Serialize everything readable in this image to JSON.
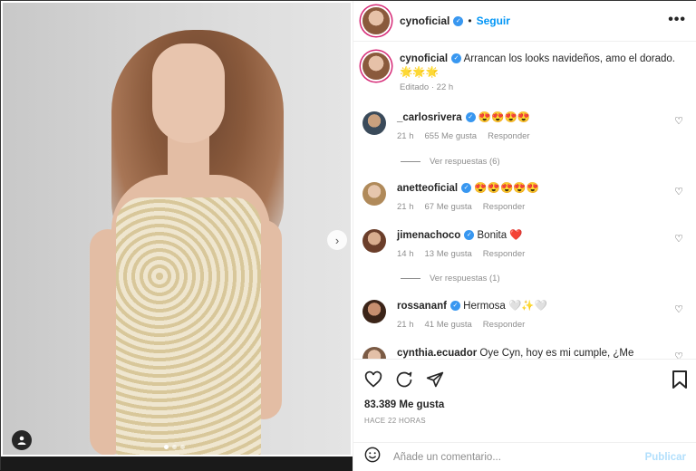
{
  "post": {
    "username": "cynoficial",
    "follow_label": "Seguir",
    "more_label": "•••",
    "caption_text": "Arrancan los looks navideños, amo el dorado. 🌟🌟🌟",
    "caption_meta": "Editado · 22 h"
  },
  "comments": [
    {
      "user": "_carlosrivera",
      "text": "😍😍😍😍",
      "time": "21 h",
      "likes": "655 Me gusta",
      "reply": "Responder",
      "view_replies": "Ver respuestas (6)"
    },
    {
      "user": "anetteoficial",
      "text": "😍😍😍😍😍",
      "time": "21 h",
      "likes": "67 Me gusta",
      "reply": "Responder",
      "view_replies": ""
    },
    {
      "user": "jimenachoco",
      "text": "Bonita ❤️",
      "time": "14 h",
      "likes": "13 Me gusta",
      "reply": "Responder",
      "view_replies": "Ver respuestas (1)"
    },
    {
      "user": "rossananf",
      "text": "Hermosa 🤍✨🤍",
      "time": "21 h",
      "likes": "41 Me gusta",
      "reply": "Responder",
      "view_replies": ""
    },
    {
      "user": "cynthia.ecuador",
      "text": "Oye Cyn, hoy es mi cumple, ¿Me saludas?▯",
      "time": "",
      "likes": "",
      "reply": "",
      "view_replies": ""
    }
  ],
  "actions": {
    "likes_count": "83.389 Me gusta",
    "time_ago": "HACE 22 HORAS"
  },
  "composer": {
    "placeholder": "Añade un comentario...",
    "publish_label": "Publicar"
  },
  "colors": {
    "accent_blue": "#0095f6",
    "publish_disabled": "#b2dffc",
    "muted_text": "#8e8e8e"
  },
  "icons": [
    "more-icon",
    "heart-icon",
    "comment-icon",
    "share-icon",
    "bookmark-icon",
    "emoji-icon",
    "next-arrow-icon",
    "tag-user-icon",
    "verified-badge-icon"
  ]
}
